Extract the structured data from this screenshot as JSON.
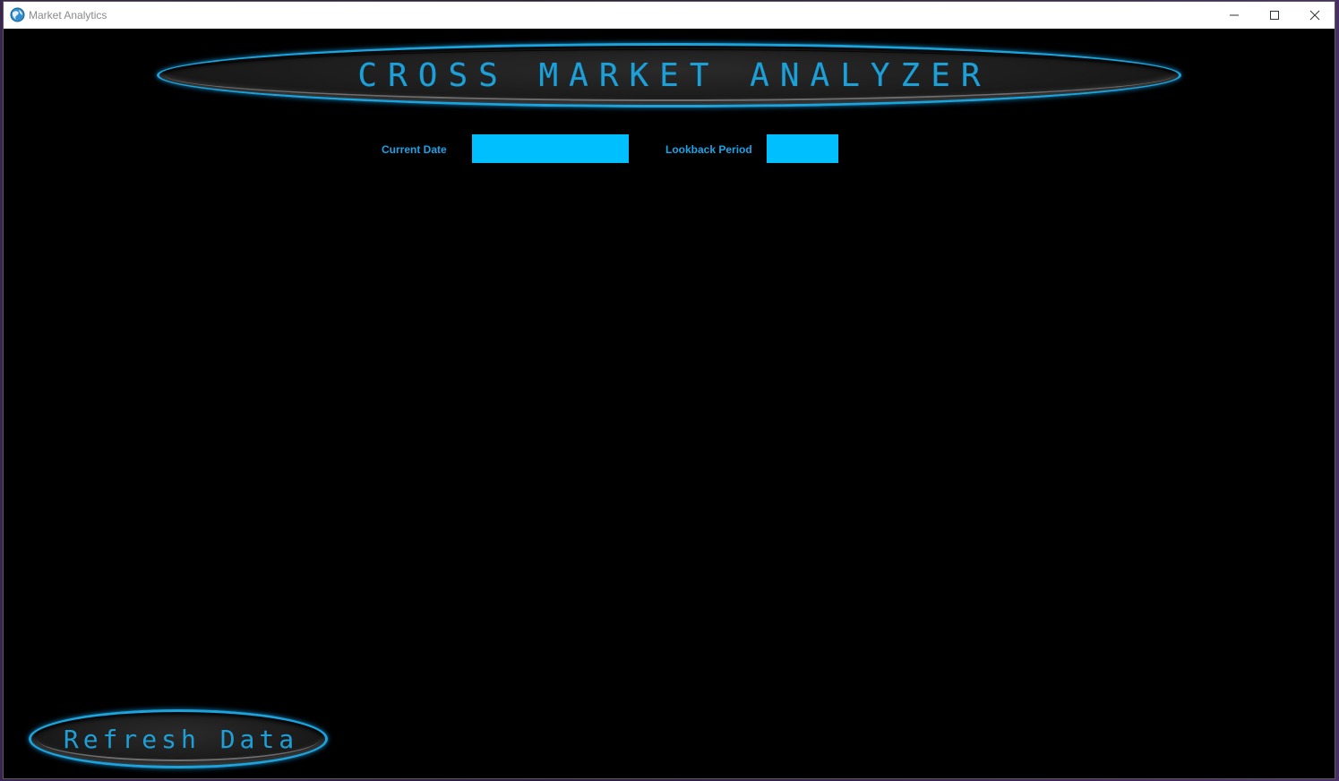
{
  "window": {
    "title": "Market Analytics",
    "app_icon": "globe-icon",
    "controls": {
      "minimize_icon": "minimize-icon",
      "maximize_icon": "maximize-icon",
      "close_icon": "close-icon"
    }
  },
  "header": {
    "title": "CROSS MARKET ANALYZER"
  },
  "controls": {
    "current_date": {
      "label": "Current Date",
      "value": "",
      "placeholder": ""
    },
    "lookback_period": {
      "label": "Lookback Period",
      "value": "",
      "placeholder": ""
    }
  },
  "actions": {
    "refresh_label": "Refresh Data"
  },
  "colors": {
    "accent": "#1aa3dc",
    "input_fill": "#00bfff",
    "background": "#000000",
    "label_text": "#1aa3e6"
  }
}
